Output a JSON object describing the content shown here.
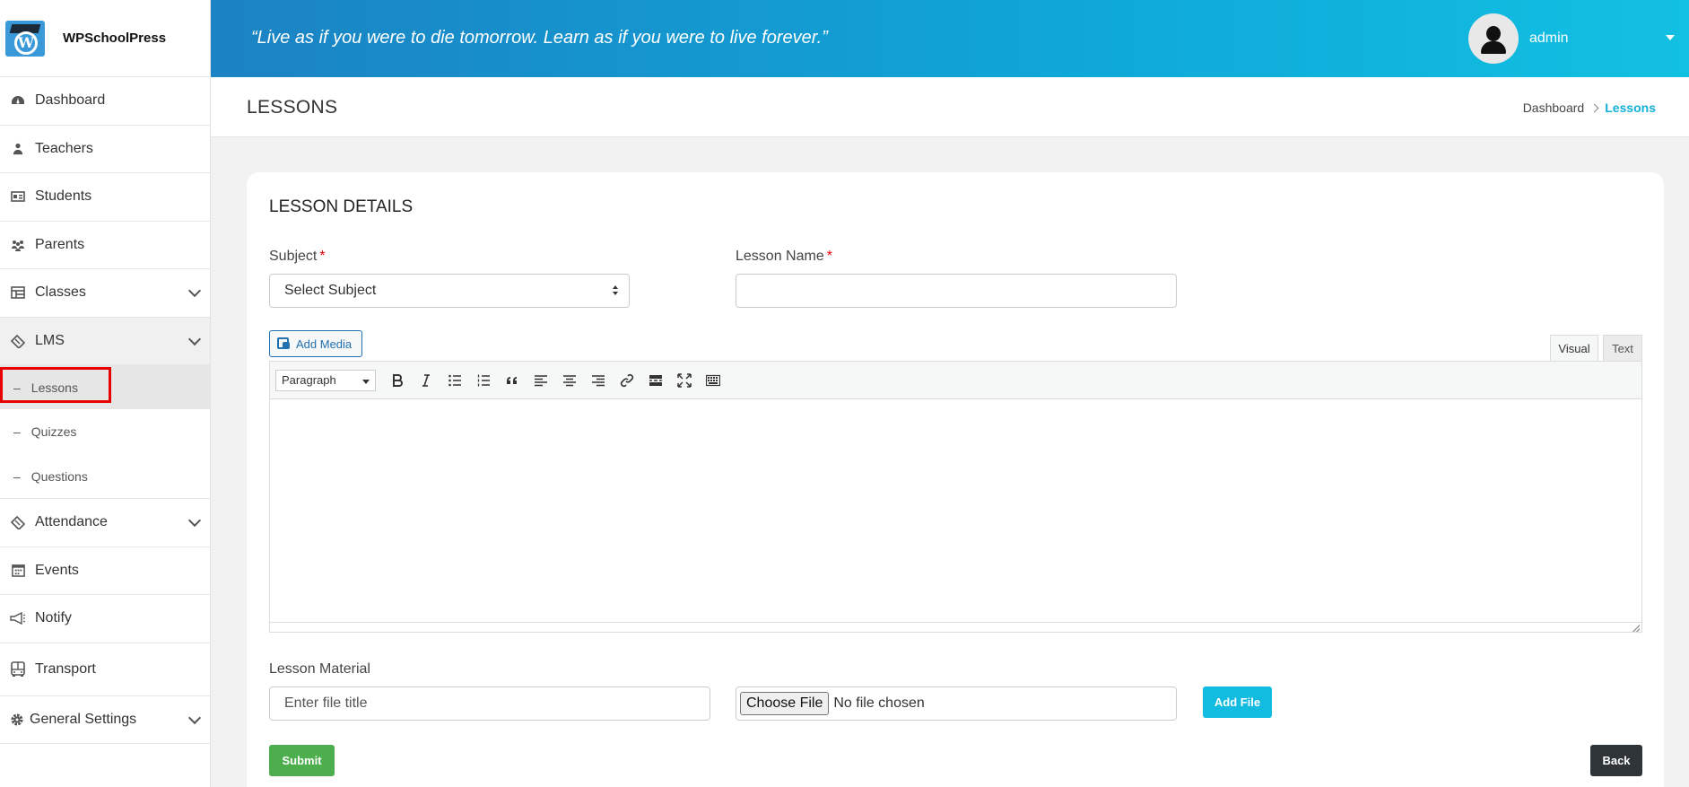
{
  "brand": {
    "name": "WPSchoolPress",
    "logo_icon": "school-logo-icon"
  },
  "sidebar": {
    "items": [
      {
        "label": "Dashboard",
        "icon": "dashboard-gauge-icon"
      },
      {
        "label": "Teachers",
        "icon": "teacher-user-icon"
      },
      {
        "label": "Students",
        "icon": "student-card-icon"
      },
      {
        "label": "Parents",
        "icon": "parents-group-icon"
      },
      {
        "label": "Classes",
        "icon": "classes-table-icon",
        "expandable": true
      },
      {
        "label": "LMS",
        "icon": "lms-ticket-icon",
        "expandable": true,
        "expanded": true
      },
      {
        "label": "Attendance",
        "icon": "attendance-ticket-icon",
        "expandable": true
      },
      {
        "label": "Events",
        "icon": "calendar-icon"
      },
      {
        "label": "Notify",
        "icon": "megaphone-icon"
      },
      {
        "label": "Transport",
        "icon": "bus-icon"
      },
      {
        "label": "General Settings",
        "icon": "gear-icon",
        "expandable": true
      }
    ],
    "lms_sub": [
      {
        "label": "Lessons",
        "active": true
      },
      {
        "label": "Quizzes"
      },
      {
        "label": "Questions"
      }
    ],
    "dash": "–"
  },
  "header": {
    "quote": "“Live as if you were to die tomorrow. Learn as if you were to live forever.”",
    "user": "admin"
  },
  "page": {
    "title": "LESSONS",
    "breadcrumb": {
      "home": "Dashboard",
      "current": "Lessons"
    }
  },
  "form": {
    "section_title": "LESSON DETAILS",
    "subject_label": "Subject",
    "required_mark": "*",
    "subject_value": "Select Subject",
    "lesson_name_label": "Lesson Name",
    "lesson_name_value": "",
    "add_media": "Add Media",
    "tab_visual": "Visual",
    "tab_text": "Text",
    "paragraph": "Paragraph",
    "lesson_material_label": "Lesson Material",
    "file_title_placeholder": "Enter file title",
    "choose_file": "Choose File",
    "no_file": "No file chosen",
    "add_file": "Add File",
    "submit": "Submit",
    "back": "Back"
  },
  "colors": {
    "header_gradient_start": "#1b82c3",
    "header_gradient_end": "#12c0e2",
    "accent": "#11b0d8",
    "submit": "#4cae4c",
    "back": "#2f3438",
    "highlight_box": "#e60000"
  }
}
